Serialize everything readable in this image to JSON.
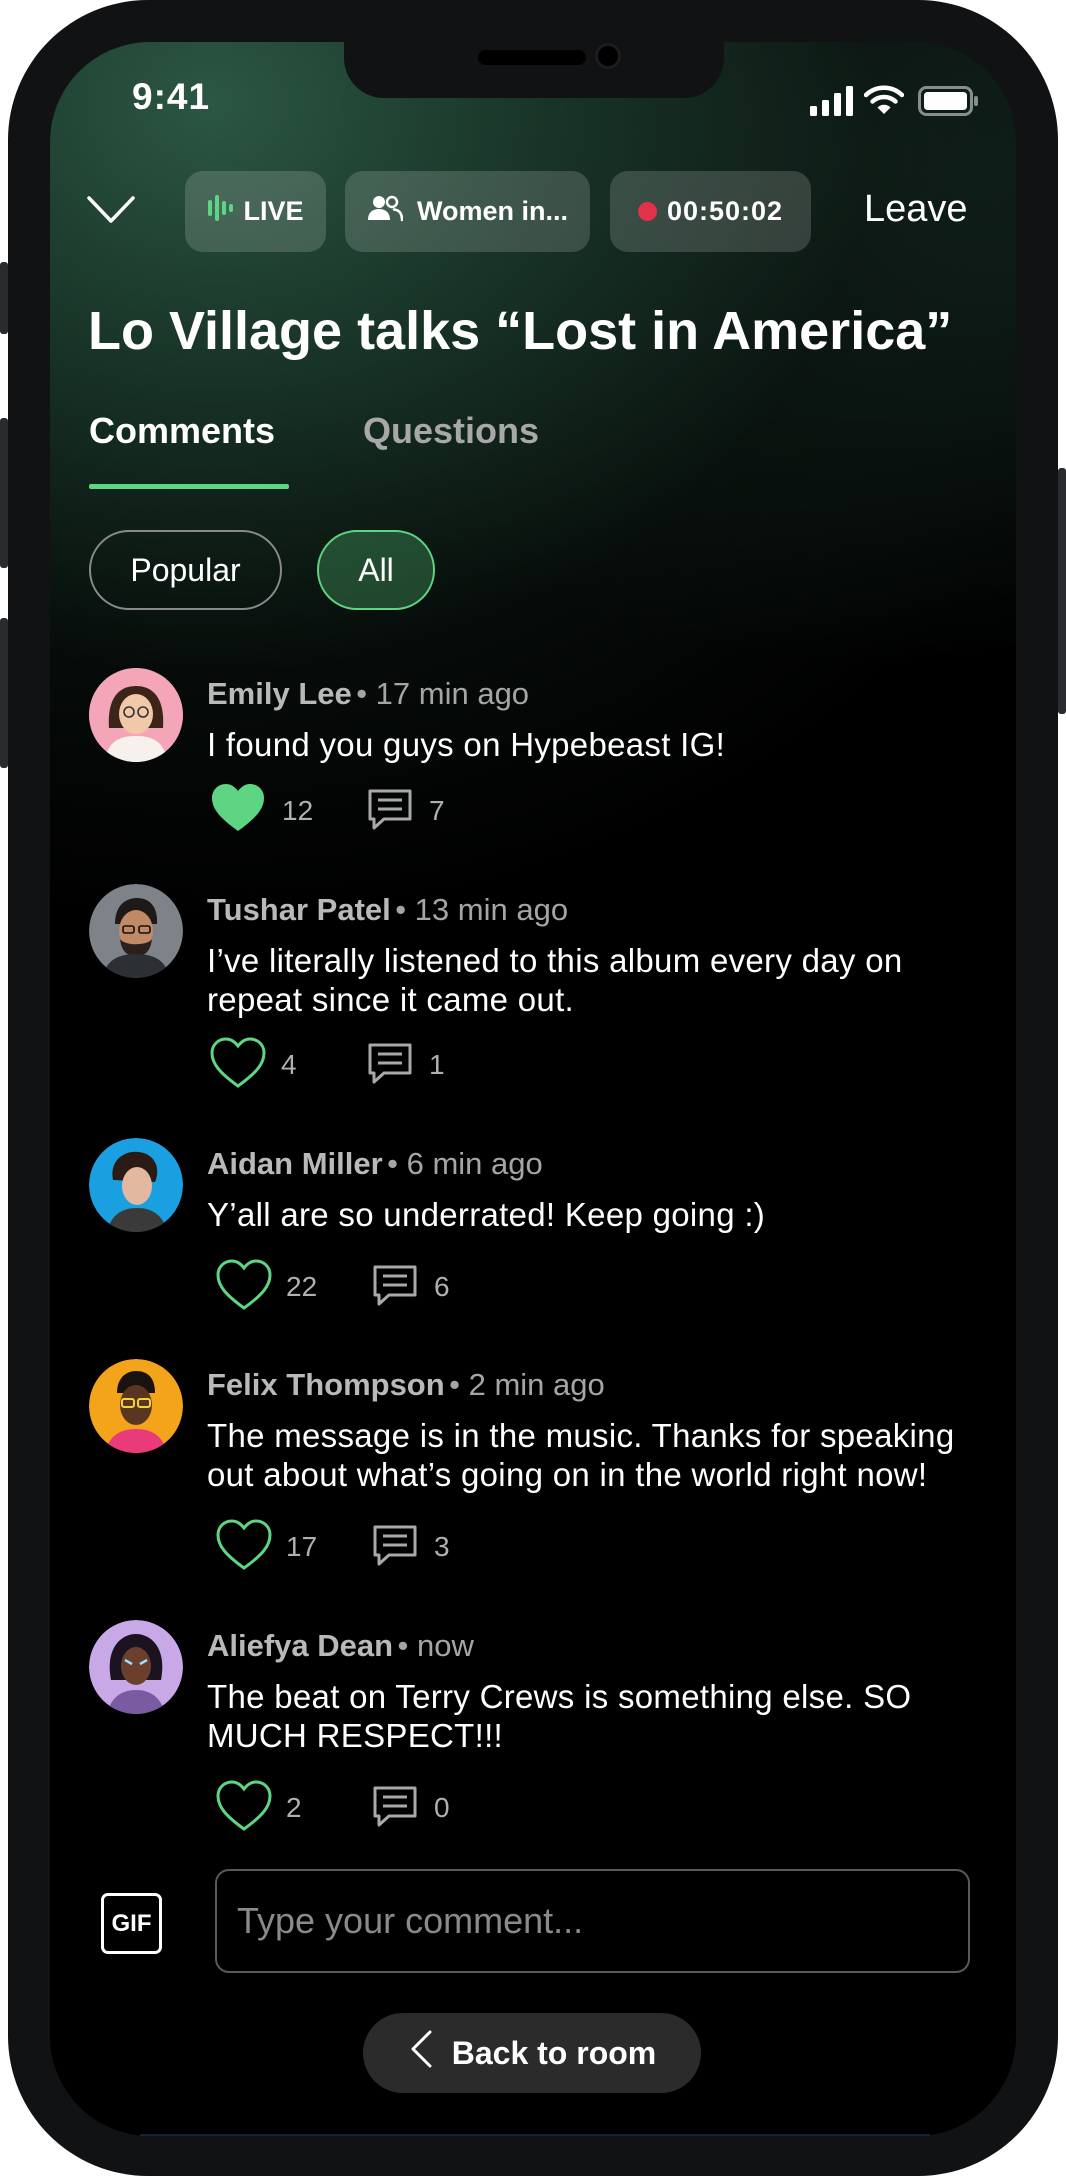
{
  "status_bar": {
    "time": "9:41"
  },
  "header": {
    "live_label": "LIVE",
    "room_label": "Women in...",
    "timer": "00:50:02",
    "leave_label": "Leave"
  },
  "title": "Lo Village talks “Lost in America”",
  "tabs": [
    {
      "label": "Comments",
      "active": true
    },
    {
      "label": "Questions",
      "active": false
    }
  ],
  "filters": [
    {
      "label": "Popular",
      "selected": false
    },
    {
      "label": "All",
      "selected": true
    }
  ],
  "comments": [
    {
      "name": "Emily Lee",
      "time": "• 17 min ago",
      "text": "I found you guys on Hypebeast IG!",
      "likes": "12",
      "replies": "7",
      "liked": true
    },
    {
      "name": "Tushar Patel",
      "time": "• 13 min ago",
      "text": "I’ve literally listened to this album every day on repeat since it came out.",
      "likes": "4",
      "replies": "1",
      "liked": false
    },
    {
      "name": "Aidan Miller",
      "time": "• 6 min ago",
      "text": "Y’all are so underrated! Keep going :)",
      "likes": "22",
      "replies": "6",
      "liked": false
    },
    {
      "name": "Felix Thompson",
      "time": "• 2 min ago",
      "text": "The message is in the music. Thanks for speaking out about what’s going on in the world right now!",
      "likes": "17",
      "replies": "3",
      "liked": false
    },
    {
      "name": "Aliefya Dean",
      "time": "• now",
      "text": "The beat on Terry Crews is something else. SO MUCH RESPECT!!!",
      "likes": "2",
      "replies": "0",
      "liked": false
    }
  ],
  "composer": {
    "gif_label": "GIF",
    "placeholder": "Type your comment..."
  },
  "back_button": {
    "label": "Back to room"
  },
  "colors": {
    "accent_green": "#5ed583",
    "recording_red": "#e0324a"
  }
}
